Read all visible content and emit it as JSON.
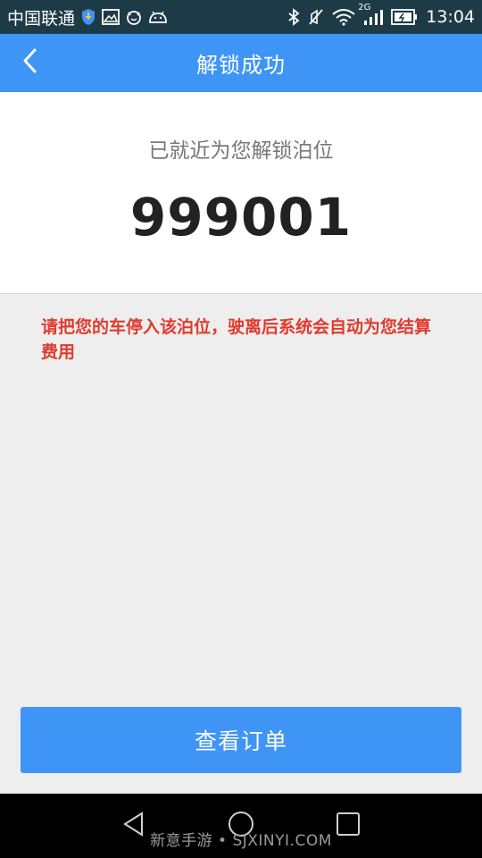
{
  "status_bar": {
    "carrier": "中国联通",
    "network_type": "2G",
    "time": "13:04",
    "icons": [
      "shield-icon",
      "image-icon",
      "cat-icon",
      "android-icon",
      "bluetooth-icon",
      "mute-icon",
      "wifi-icon",
      "signal-icon",
      "battery-icon"
    ]
  },
  "header": {
    "title": "解锁成功",
    "back_icon": "chevron-left-icon"
  },
  "result": {
    "subtitle": "已就近为您解锁泊位",
    "spot_code": "999001"
  },
  "notice": {
    "text": "请把您的车停入该泊位，驶离后系统会自动为您结算费用"
  },
  "actions": {
    "view_order_label": "查看订单"
  },
  "nav_bar": {
    "watermark": "新意手游 • SJXINYI.COM"
  },
  "colors": {
    "accent": "#3f95f5",
    "status_bar": "#1d3b47",
    "warning_text": "#e03b2f",
    "background": "#eeeeee"
  }
}
